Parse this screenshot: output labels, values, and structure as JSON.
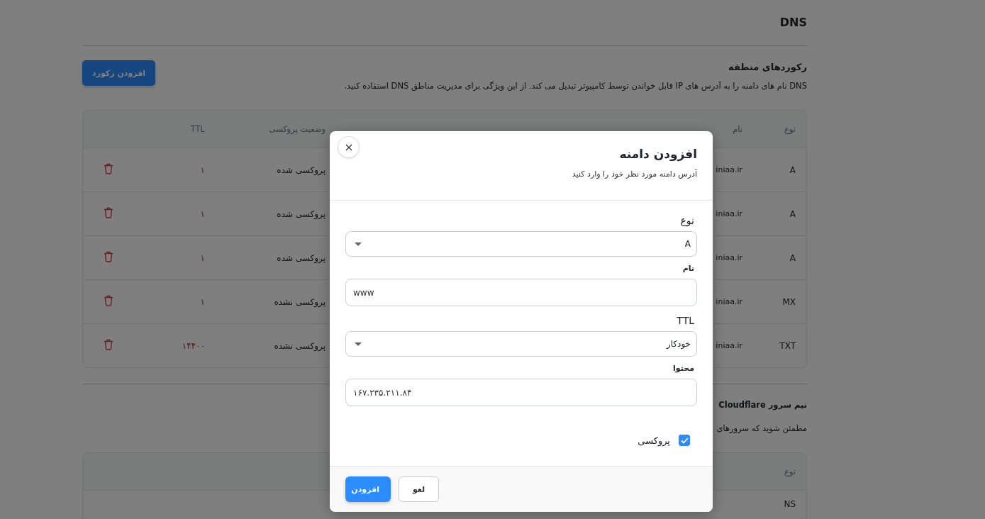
{
  "page": {
    "title": "DNS"
  },
  "zone_records": {
    "title": "رکوردهای منطقه",
    "add_button": "افزودن رکورد",
    "description": "DNS نام های دامنه را به آدرس های IP قابل خواندن توسط کامپیوتر تبدیل می کند. از این ویژگی برای مدیریت مناطق DNS استفاده کنید.",
    "table": {
      "columns": [
        "نوع",
        "نام",
        "وضعیت پروکسی",
        "TTL"
      ],
      "rows": [
        {
          "type": "A",
          "name": "iniaa.ir",
          "proxy_status": "پروکسی شده",
          "ttl": "۱"
        },
        {
          "type": "A",
          "name": "iniaa.ir",
          "proxy_status": "پروکسی شده",
          "ttl": "۱"
        },
        {
          "type": "A",
          "name": "iniaa.ir",
          "proxy_status": "پروکسی شده",
          "ttl": "۱"
        },
        {
          "type": "MX",
          "name": "iniaa.ir",
          "proxy_status": "پروکسی نشده",
          "ttl": "۱"
        },
        {
          "type": "TXT",
          "name": "iniaa.ir",
          "proxy_status": "پروکسی نشده",
          "ttl": "۱۴۴۰۰"
        }
      ]
    }
  },
  "nameservers": {
    "title": "نیم سرور Cloudflare",
    "description": "مطمئن شوید که سرورهای",
    "table": {
      "columns": [
        "نوع"
      ],
      "rows": [
        {
          "type": "NS"
        }
      ]
    }
  },
  "dialog": {
    "title": "افزودن دامنه",
    "subtitle": "آدرس دامنه مورد نظر خود را وارد کنید",
    "fields": [
      {
        "kind": "select",
        "label": "نوع",
        "value": "A"
      },
      {
        "kind": "input",
        "label": "نام",
        "value": "www"
      },
      {
        "kind": "select",
        "label": "TTL",
        "value": "خودکار"
      },
      {
        "kind": "input",
        "label": "محتوا",
        "value": "۱۶۷.۲۳۵.۲۱۱.۸۴"
      }
    ],
    "proxy": {
      "label": "پروکسی",
      "checked": true
    },
    "buttons": [
      {
        "kind": "secondary",
        "label": "لغو"
      },
      {
        "kind": "primary",
        "label": "افزودن"
      }
    ]
  }
}
